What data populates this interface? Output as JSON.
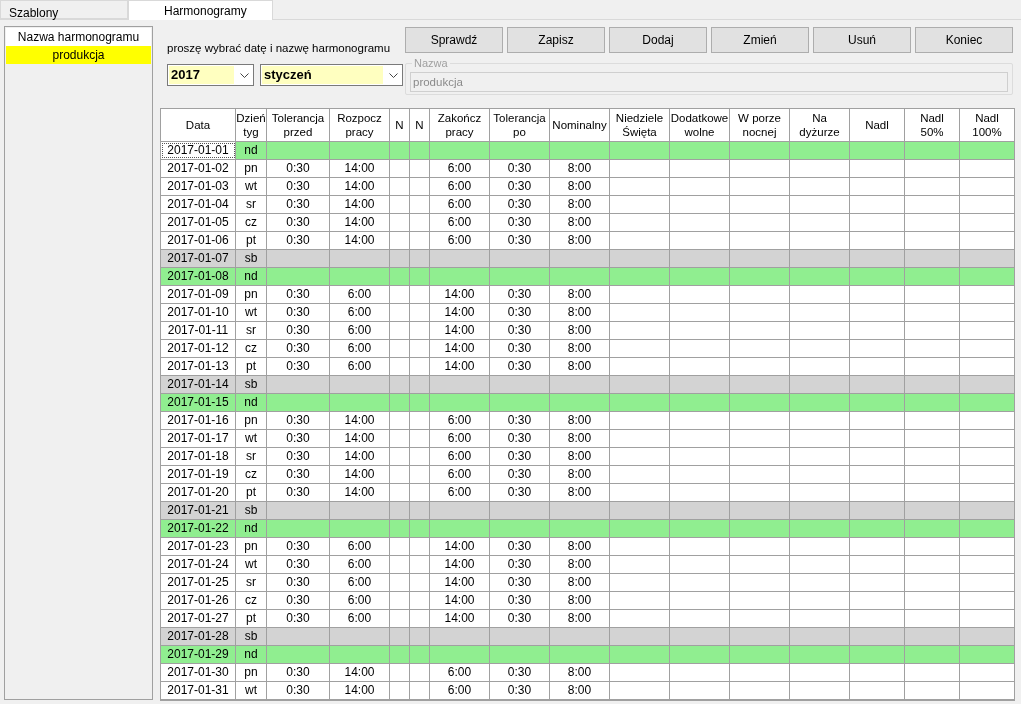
{
  "tabs": [
    {
      "label": "Szablony",
      "selected": false
    },
    {
      "label": "Harmonogramy",
      "selected": true
    }
  ],
  "sidebar": {
    "header": "Nazwa harmonogramu",
    "items": [
      {
        "label": "produkcja",
        "selected": true
      }
    ]
  },
  "instruction": "proszę wybrać datę i nazwę harmonogramu",
  "year_select": {
    "value": "2017"
  },
  "month_select": {
    "value": "styczeń"
  },
  "buttons": [
    "Sprawdź",
    "Zapisz",
    "Dodaj",
    "Zmień",
    "Usuń",
    "Koniec"
  ],
  "name_group": {
    "label": "Nazwa",
    "value": "produkcja",
    "disabled": true
  },
  "table": {
    "columns": [
      "Data",
      "Dzień\ntyg",
      "Tolerancja\nprzed",
      "Rozpocz\npracy",
      "N",
      "N",
      "Zakończ\npracy",
      "Tolerancja\npo",
      "Nominalny",
      "Niedziele\nŚwięta",
      "Dodatkowe\nwolne",
      "W porze\nnocnej",
      "Na\ndyżurze",
      "Nadl",
      "Nadl\n50%",
      "Nadl\n100%"
    ],
    "rows": [
      {
        "date": "2017-01-01",
        "day": "nd",
        "kind": "sunday",
        "selected": true
      },
      {
        "date": "2017-01-02",
        "day": "pn",
        "kind": "workday",
        "selected": false,
        "tolerance_before": "0:30",
        "start": "14:00",
        "end": "6:00",
        "tolerance_after": "0:30",
        "nominal": "8:00"
      },
      {
        "date": "2017-01-03",
        "day": "wt",
        "kind": "workday",
        "selected": false,
        "tolerance_before": "0:30",
        "start": "14:00",
        "end": "6:00",
        "tolerance_after": "0:30",
        "nominal": "8:00"
      },
      {
        "date": "2017-01-04",
        "day": "sr",
        "kind": "workday",
        "selected": false,
        "tolerance_before": "0:30",
        "start": "14:00",
        "end": "6:00",
        "tolerance_after": "0:30",
        "nominal": "8:00"
      },
      {
        "date": "2017-01-05",
        "day": "cz",
        "kind": "workday",
        "selected": false,
        "tolerance_before": "0:30",
        "start": "14:00",
        "end": "6:00",
        "tolerance_after": "0:30",
        "nominal": "8:00"
      },
      {
        "date": "2017-01-06",
        "day": "pt",
        "kind": "workday",
        "selected": false,
        "tolerance_before": "0:30",
        "start": "14:00",
        "end": "6:00",
        "tolerance_after": "0:30",
        "nominal": "8:00"
      },
      {
        "date": "2017-01-07",
        "day": "sb",
        "kind": "saturday",
        "selected": false
      },
      {
        "date": "2017-01-08",
        "day": "nd",
        "kind": "sunday",
        "selected": false
      },
      {
        "date": "2017-01-09",
        "day": "pn",
        "kind": "workday",
        "selected": false,
        "tolerance_before": "0:30",
        "start": "6:00",
        "end": "14:00",
        "tolerance_after": "0:30",
        "nominal": "8:00"
      },
      {
        "date": "2017-01-10",
        "day": "wt",
        "kind": "workday",
        "selected": false,
        "tolerance_before": "0:30",
        "start": "6:00",
        "end": "14:00",
        "tolerance_after": "0:30",
        "nominal": "8:00"
      },
      {
        "date": "2017-01-11",
        "day": "sr",
        "kind": "workday",
        "selected": false,
        "tolerance_before": "0:30",
        "start": "6:00",
        "end": "14:00",
        "tolerance_after": "0:30",
        "nominal": "8:00"
      },
      {
        "date": "2017-01-12",
        "day": "cz",
        "kind": "workday",
        "selected": false,
        "tolerance_before": "0:30",
        "start": "6:00",
        "end": "14:00",
        "tolerance_after": "0:30",
        "nominal": "8:00"
      },
      {
        "date": "2017-01-13",
        "day": "pt",
        "kind": "workday",
        "selected": false,
        "tolerance_before": "0:30",
        "start": "6:00",
        "end": "14:00",
        "tolerance_after": "0:30",
        "nominal": "8:00"
      },
      {
        "date": "2017-01-14",
        "day": "sb",
        "kind": "saturday",
        "selected": false
      },
      {
        "date": "2017-01-15",
        "day": "nd",
        "kind": "sunday",
        "selected": false
      },
      {
        "date": "2017-01-16",
        "day": "pn",
        "kind": "workday",
        "selected": false,
        "tolerance_before": "0:30",
        "start": "14:00",
        "end": "6:00",
        "tolerance_after": "0:30",
        "nominal": "8:00"
      },
      {
        "date": "2017-01-17",
        "day": "wt",
        "kind": "workday",
        "selected": false,
        "tolerance_before": "0:30",
        "start": "14:00",
        "end": "6:00",
        "tolerance_after": "0:30",
        "nominal": "8:00"
      },
      {
        "date": "2017-01-18",
        "day": "sr",
        "kind": "workday",
        "selected": false,
        "tolerance_before": "0:30",
        "start": "14:00",
        "end": "6:00",
        "tolerance_after": "0:30",
        "nominal": "8:00"
      },
      {
        "date": "2017-01-19",
        "day": "cz",
        "kind": "workday",
        "selected": false,
        "tolerance_before": "0:30",
        "start": "14:00",
        "end": "6:00",
        "tolerance_after": "0:30",
        "nominal": "8:00"
      },
      {
        "date": "2017-01-20",
        "day": "pt",
        "kind": "workday",
        "selected": false,
        "tolerance_before": "0:30",
        "start": "14:00",
        "end": "6:00",
        "tolerance_after": "0:30",
        "nominal": "8:00"
      },
      {
        "date": "2017-01-21",
        "day": "sb",
        "kind": "saturday",
        "selected": false
      },
      {
        "date": "2017-01-22",
        "day": "nd",
        "kind": "sunday",
        "selected": false
      },
      {
        "date": "2017-01-23",
        "day": "pn",
        "kind": "workday",
        "selected": false,
        "tolerance_before": "0:30",
        "start": "6:00",
        "end": "14:00",
        "tolerance_after": "0:30",
        "nominal": "8:00"
      },
      {
        "date": "2017-01-24",
        "day": "wt",
        "kind": "workday",
        "selected": false,
        "tolerance_before": "0:30",
        "start": "6:00",
        "end": "14:00",
        "tolerance_after": "0:30",
        "nominal": "8:00"
      },
      {
        "date": "2017-01-25",
        "day": "sr",
        "kind": "workday",
        "selected": false,
        "tolerance_before": "0:30",
        "start": "6:00",
        "end": "14:00",
        "tolerance_after": "0:30",
        "nominal": "8:00"
      },
      {
        "date": "2017-01-26",
        "day": "cz",
        "kind": "workday",
        "selected": false,
        "tolerance_before": "0:30",
        "start": "6:00",
        "end": "14:00",
        "tolerance_after": "0:30",
        "nominal": "8:00"
      },
      {
        "date": "2017-01-27",
        "day": "pt",
        "kind": "workday",
        "selected": false,
        "tolerance_before": "0:30",
        "start": "6:00",
        "end": "14:00",
        "tolerance_after": "0:30",
        "nominal": "8:00"
      },
      {
        "date": "2017-01-28",
        "day": "sb",
        "kind": "saturday",
        "selected": false
      },
      {
        "date": "2017-01-29",
        "day": "nd",
        "kind": "sunday",
        "selected": false
      },
      {
        "date": "2017-01-30",
        "day": "pn",
        "kind": "workday",
        "selected": false,
        "tolerance_before": "0:30",
        "start": "14:00",
        "end": "6:00",
        "tolerance_after": "0:30",
        "nominal": "8:00"
      },
      {
        "date": "2017-01-31",
        "day": "wt",
        "kind": "workday",
        "selected": false,
        "tolerance_before": "0:30",
        "start": "14:00",
        "end": "6:00",
        "tolerance_after": "0:30",
        "nominal": "8:00"
      }
    ]
  }
}
